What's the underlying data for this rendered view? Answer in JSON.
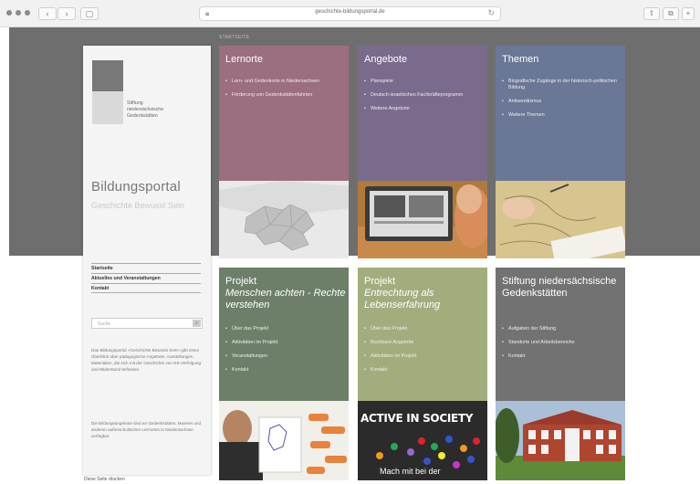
{
  "browser": {
    "url": "geschichte-bildungsportal.de",
    "back_label": "‹",
    "forward_label": "›",
    "sidebar_label": "▢",
    "reload_label": "↻",
    "share_label": "⇪",
    "tabs_label": "⧉",
    "add_label": "+",
    "lock_icon": "lock-icon"
  },
  "breadcrumb": "STARTSEITE",
  "sidebar": {
    "logo_text": "Stiftung\nniedersächsische\nGedenkstätten",
    "title": "Bildungsportal",
    "subtitle": "Geschichte Bewusst Sein",
    "nav": [
      "Startseite",
      "Aktuelles und Veranstaltungen",
      "Kontakt"
    ],
    "search_placeholder": "Suche",
    "search_button": "⌕",
    "text_1": "Das Bildungsportal »Geschichte Bewusst Sein« gibt einen Überblick über pädagogische Angebote, Ausstellungen, Materialien, die sich mit der Geschichte von NS-Verfolgung und Widerstand befassen.",
    "text_2": "Die Bildungsangebote sind an Gedenkstätten, Museen und anderen außerschulischen Lernorten in Niedersachsen verfügbar.",
    "footer": "Diese Seite drucken"
  },
  "tiles": [
    {
      "title": "Lernorte",
      "title_italic": "",
      "color": "#9b6e80",
      "items": [
        "Lern- und Gedenkorte in Niedersachsen",
        "Förderung von Gedenkstättenfahrten"
      ]
    },
    {
      "title": "Angebote",
      "title_italic": "",
      "color": "#7a6a8c",
      "items": [
        "Planspiele",
        "Deutsch-israelisches Fachkräfteprogramm",
        "Weitere Angebote"
      ]
    },
    {
      "title": "Themen",
      "title_italic": "",
      "color": "#6a7796",
      "items": [
        "Biografische Zugänge in der historisch-politischen Bildung",
        "Antisemitismus",
        "Weitere Themen"
      ]
    },
    {
      "title": "Projekt",
      "title_italic": "Menschen achten - Rechte verstehen",
      "color": "#6d7f68",
      "items": [
        "Über das Projekt",
        "Aktivitäten im Projekt",
        "Veranstaltungen",
        "Kontakt"
      ]
    },
    {
      "title": "Projekt",
      "title_italic": "Entrechtung als Lebenserfahrung",
      "color": "#a2ad7e",
      "items": [
        "Über das Projekt",
        "Buchbare Angebote",
        "Aktivitäten im Projekt",
        "Kontakt"
      ]
    },
    {
      "title": "Stiftung niedersächsische Gedenkstätten",
      "title_italic": "",
      "color": "#727272",
      "items": [
        "Aufgaben der Stiftung",
        "Standorte und Arbeitsbereiche",
        "Kontakt"
      ]
    }
  ],
  "sign_text": "ACTIVE IN SOCIETY",
  "sign_sub": "Mach mit bei der"
}
